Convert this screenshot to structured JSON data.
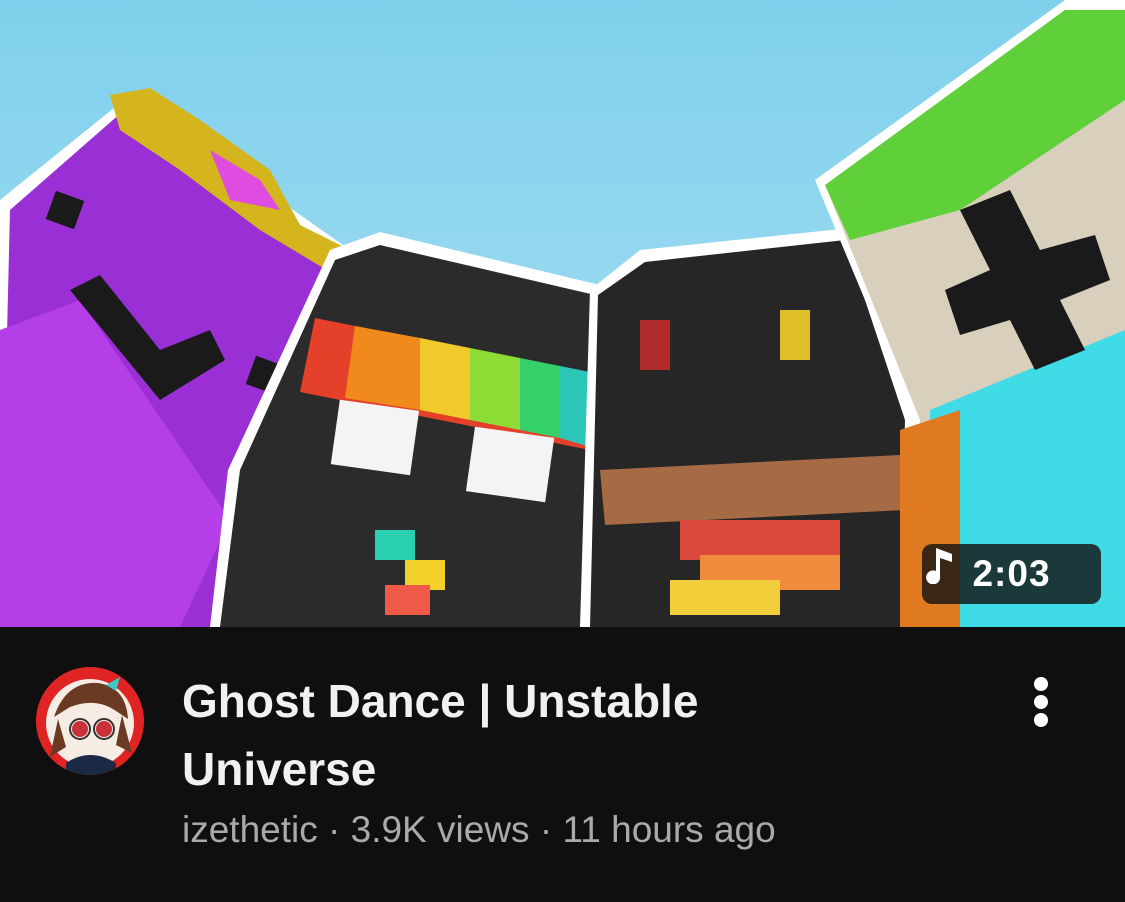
{
  "video": {
    "duration": "2:03",
    "duration_icon": "music-note-icon",
    "title": "Ghost Dance | Unstable Universe",
    "channel": "izethetic",
    "separator": "·",
    "views": "3.9K views",
    "age": "11 hours ago",
    "more_icon": "more-vertical-icon",
    "avatar_icon": "channel-avatar"
  },
  "colors": {
    "background": "#0f0f0f",
    "title_text": "#f1f1f1",
    "meta_text": "#aaaaaa",
    "sky": "#8fd6ef",
    "avatar_ring": "#e02424"
  }
}
